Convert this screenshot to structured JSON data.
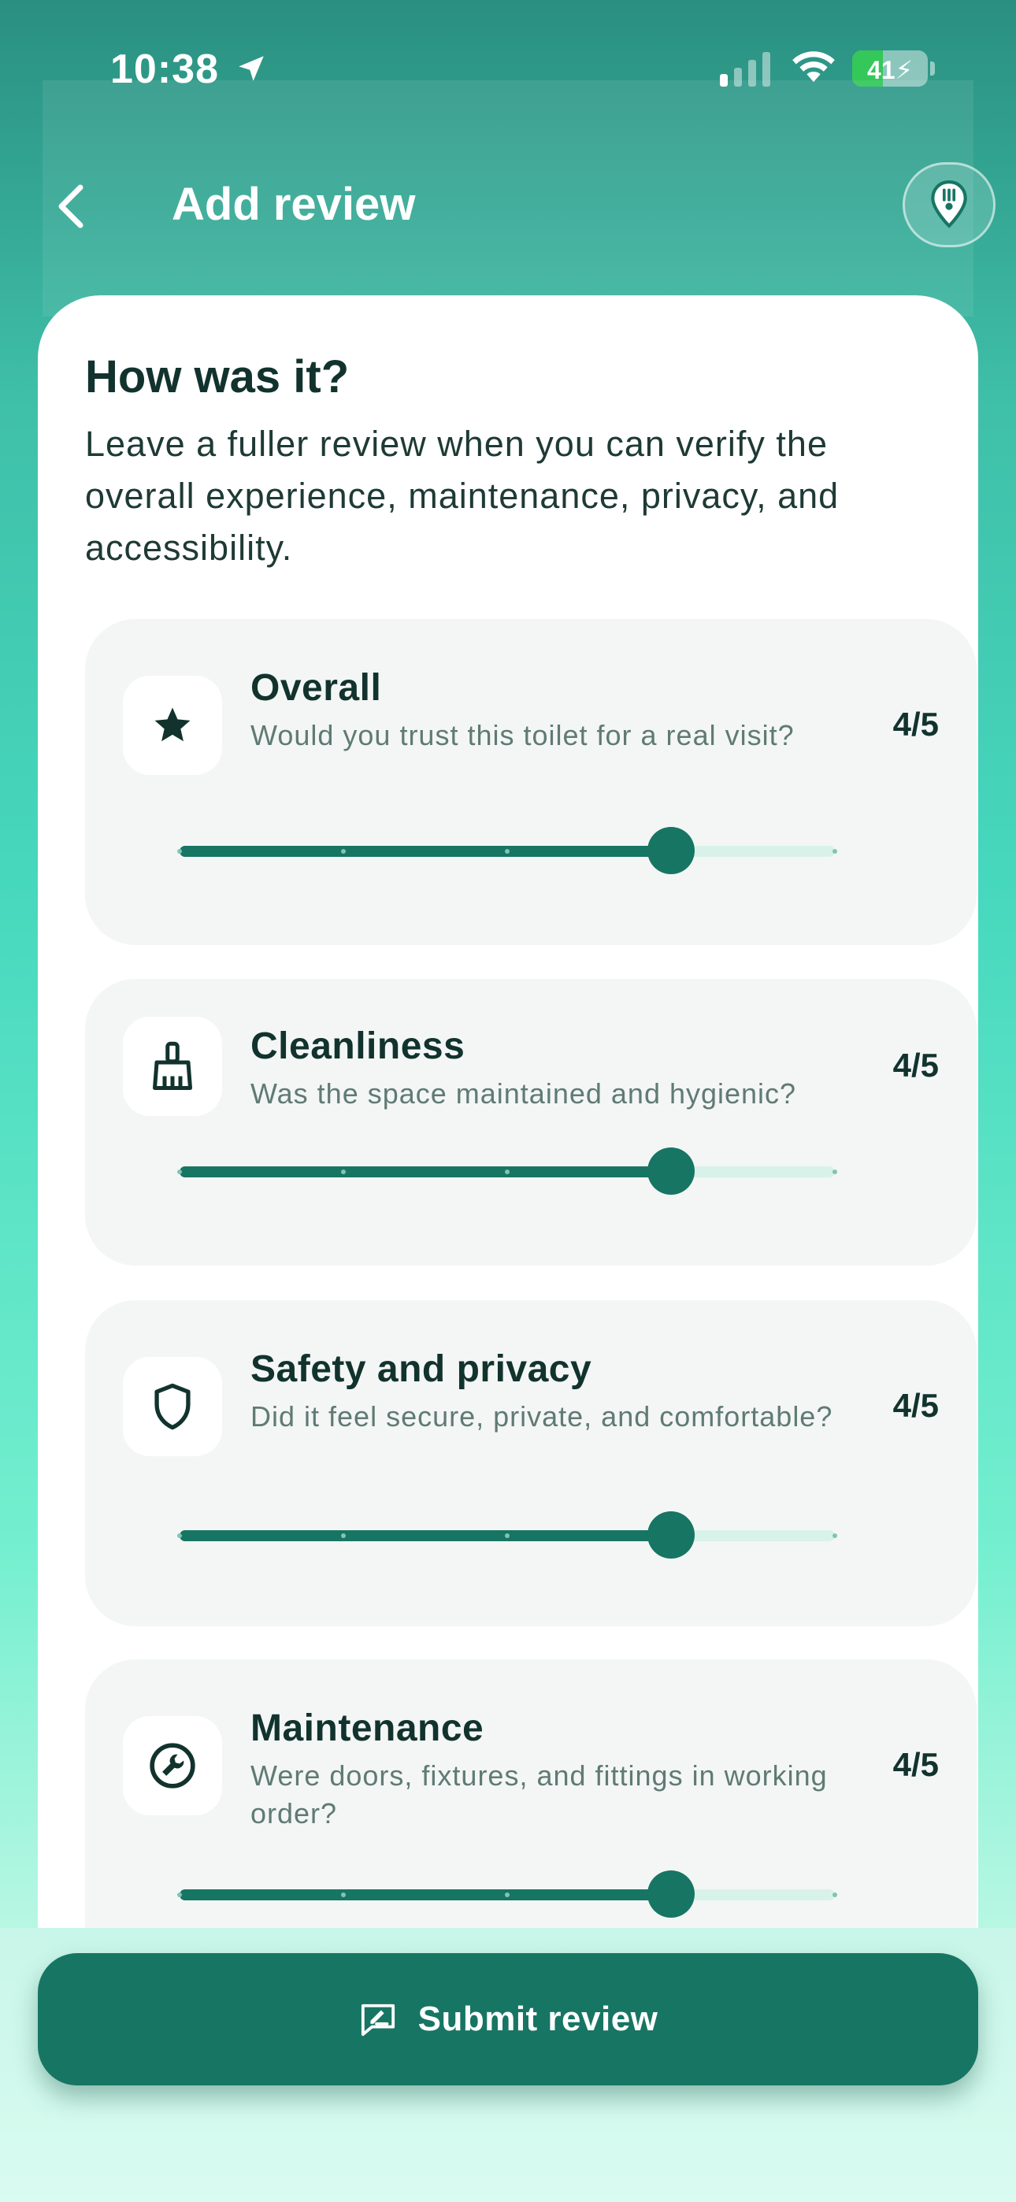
{
  "status_bar": {
    "time": "10:38",
    "battery_percent": 41,
    "battery_text": "41"
  },
  "header": {
    "title": "Add review",
    "back_icon": "chevron-left-icon",
    "action_icon": "map-pin-icon"
  },
  "card": {
    "heading": "How was it?",
    "intro": "Leave a fuller review when you can verify the overall experience, maintenance, privacy, and accessibility."
  },
  "ratings": [
    {
      "title": "Overall",
      "description": "Would you trust this toilet for a real visit?",
      "score_text": "4/5",
      "value": 4,
      "max": 5,
      "icon": "star-icon"
    },
    {
      "title": "Cleanliness",
      "description": "Was the space maintained and hygienic?",
      "score_text": "4/5",
      "value": 4,
      "max": 5,
      "icon": "broom-icon"
    },
    {
      "title": "Safety and privacy",
      "description": "Did it feel secure, private, and comfortable?",
      "score_text": "4/5",
      "value": 4,
      "max": 5,
      "icon": "shield-icon"
    },
    {
      "title": "Maintenance",
      "description": "Were doors, fixtures, and fittings in working order?",
      "score_text": "4/5",
      "value": 4,
      "max": 5,
      "icon": "wrench-icon"
    }
  ],
  "submit": {
    "label": "Submit review",
    "icon": "edit-note-icon"
  },
  "colors": {
    "accent": "#177563",
    "track": "#d8f2ea",
    "card_bg": "#ffffff",
    "item_bg": "#f3f6f5"
  }
}
